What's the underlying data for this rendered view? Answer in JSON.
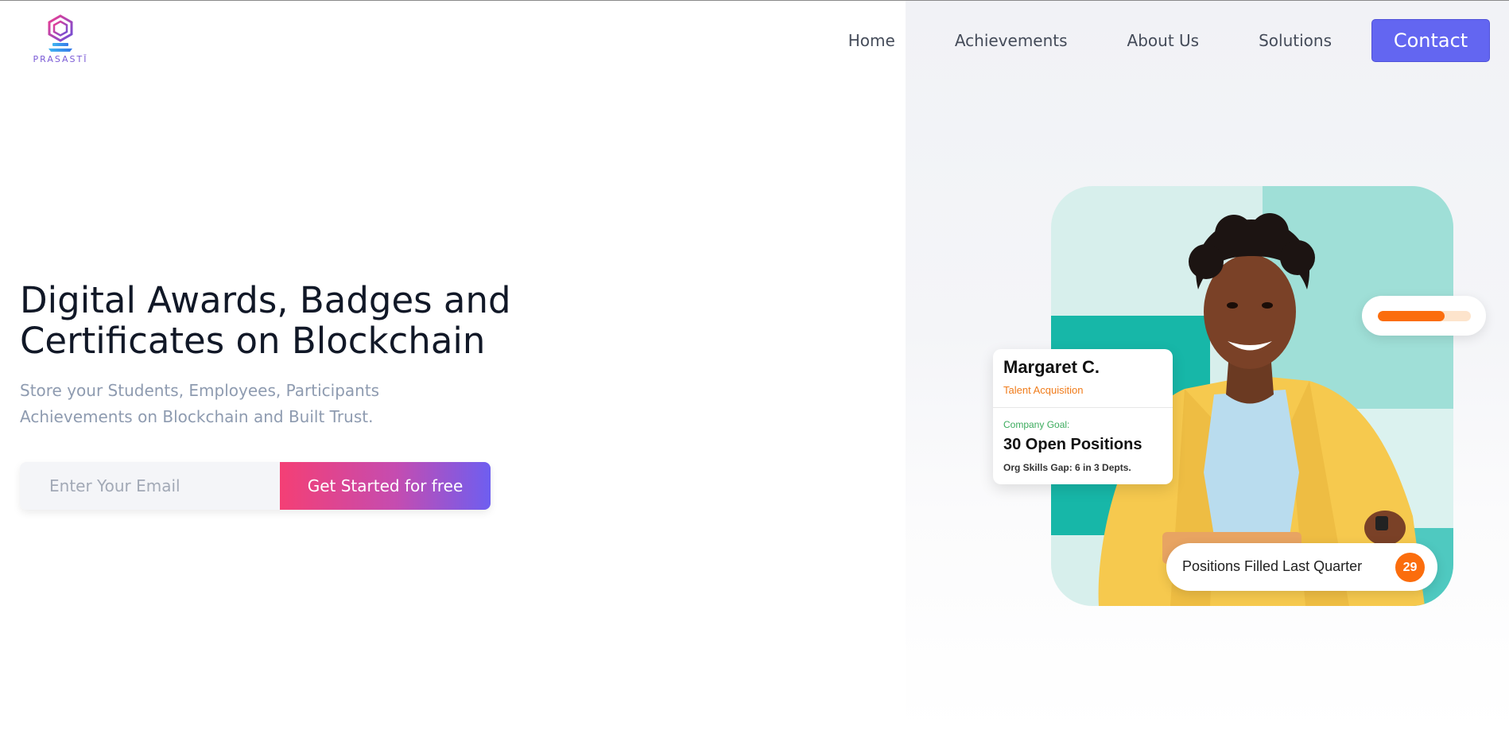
{
  "brand": {
    "name": "PRASASTĪ",
    "logo_icon": "hexagon-logo-icon"
  },
  "nav": {
    "items": [
      {
        "label": "Home"
      },
      {
        "label": "Achievements"
      },
      {
        "label": "About Us"
      },
      {
        "label": "Solutions"
      }
    ],
    "contact_label": "Contact"
  },
  "hero": {
    "title_line1": "Digital Awards, Badges and",
    "title_line2": "Certificates on Blockchain",
    "subtitle_line1": "Store your Students, Employees, Participants",
    "subtitle_line2": "Achievements on Blockchain and Built Trust.",
    "email_placeholder": "Enter Your Email",
    "cta_label": "Get Started for free"
  },
  "illustration": {
    "profile": {
      "name": "Margaret C.",
      "role": "Talent Acquisition",
      "goal_label": "Company Goal:",
      "goal_value": "30 Open Positions",
      "gap": "Org Skills Gap: 6 in 3 Depts."
    },
    "progress_fraction": 0.72,
    "filled_label": "Positions Filled Last Quarter",
    "filled_count": "29"
  },
  "colors": {
    "accent": "#6366f1",
    "cta_gradient_start": "#f43f75",
    "cta_gradient_end": "#6e5ef0",
    "orange": "#fb6d0d",
    "teal": "#17b7a8"
  }
}
